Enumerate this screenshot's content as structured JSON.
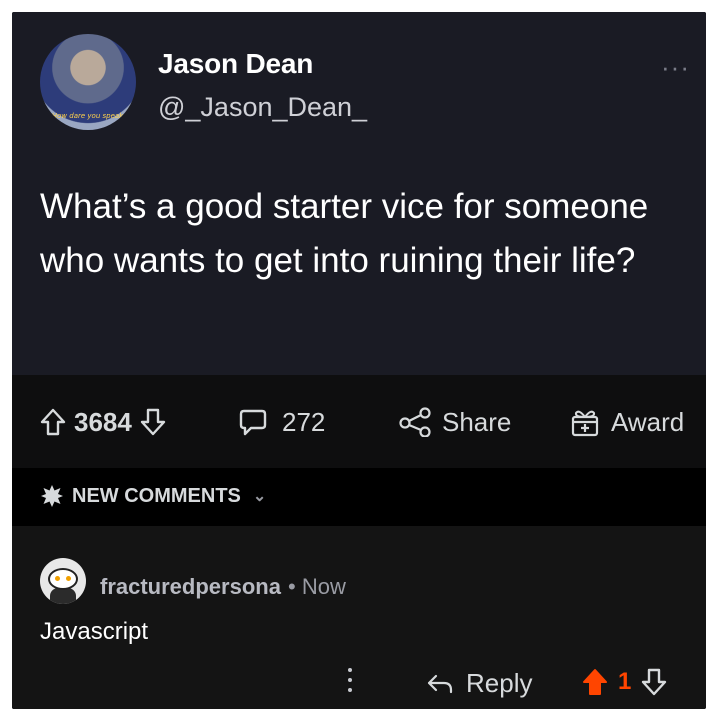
{
  "tweet": {
    "author_name": "Jason Dean",
    "handle": "@_Jason_Dean_",
    "avatar_caption": "How dare you speak !",
    "text": "What’s a good starter vice for someone who wants to get into ruining their life?",
    "more_glyph": "···"
  },
  "actions": {
    "upvotes": "3684",
    "comments": "272",
    "share_label": "Share",
    "award_label": "Award"
  },
  "new_comments": {
    "label": "NEW COMMENTS",
    "chevron": "⌄"
  },
  "comment": {
    "author": "fracturedpersona",
    "time": "• Now",
    "body": "Javascript",
    "reply_label": "Reply",
    "score": "1"
  },
  "colors": {
    "upvote_active": "#ff4500",
    "background": "#0f0f10",
    "tweet_card": "#1a1b24"
  },
  "icons": [
    "upvote-icon",
    "downvote-icon",
    "comment-icon",
    "share-icon",
    "award-icon",
    "new-comments-icon",
    "reply-icon",
    "more-icon"
  ]
}
